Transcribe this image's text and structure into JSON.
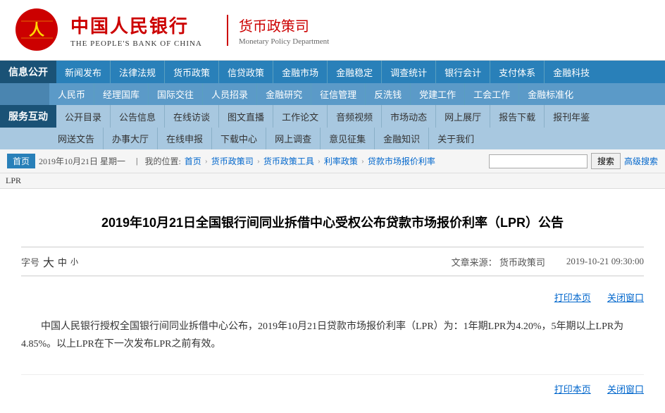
{
  "header": {
    "logo_cn": "中国人民银行",
    "logo_en": "THE PEOPLE'S BANK OF CHINA",
    "dept_cn": "货币政策司",
    "dept_en": "Monetary Policy Department"
  },
  "nav": {
    "label1": "信息公开",
    "label2": "服务互动",
    "row1": [
      "新闻发布",
      "法律法规",
      "货币政策",
      "信贷政策",
      "金融市场",
      "金融稳定",
      "调查统计",
      "银行会计",
      "支付体系",
      "金融科技"
    ],
    "row2": [
      "人民币",
      "经理国库",
      "国际交往",
      "人员招录",
      "金融研究",
      "征信管理",
      "反洗钱",
      "党建工作",
      "工会工作",
      "金融标准化"
    ],
    "row3": [
      "公开目录",
      "公告信息",
      "在线访谈",
      "图文直播",
      "工作论文",
      "音频视频",
      "市场动态",
      "网上展厅",
      "报告下载",
      "报刊年鉴"
    ],
    "row4": [
      "网送文告",
      "办事大厅",
      "在线申报",
      "下载中心",
      "网上调查",
      "意见征集",
      "金融知识",
      "关于我们"
    ]
  },
  "breadcrumb": {
    "home": "首页",
    "date": "2019年10月21日 星期一",
    "separator": "|",
    "location_label": "我的位置:首页",
    "path": [
      "货币政策司",
      "货币政策工具",
      "利率政策",
      "贷款市场报价利率"
    ],
    "lpr": "LPR"
  },
  "search": {
    "placeholder": "",
    "btn_label": "搜索",
    "advanced_label": "高级搜索"
  },
  "article": {
    "title": "2019年10月21日全国银行间同业拆借中心受权公布贷款市场报价利率（LPR）公告",
    "font_label": "字号",
    "font_large": "大",
    "font_medium": "中",
    "font_small": "小",
    "source_label": "文章来源：",
    "source": "货币政策司",
    "date": "2019-10-21  09:30:00",
    "print_label": "打印本页",
    "close_label": "关闭窗口",
    "body": "中国人民银行授权全国银行间同业拆借中心公布，2019年10月21日贷款市场报价利率（LPR）为：1年期LPR为4.20%，5年期以上LPR为4.85%。以上LPR在下一次发布LPR之前有效。",
    "print_label2": "打印本页",
    "close_label2": "关闭窗口"
  }
}
